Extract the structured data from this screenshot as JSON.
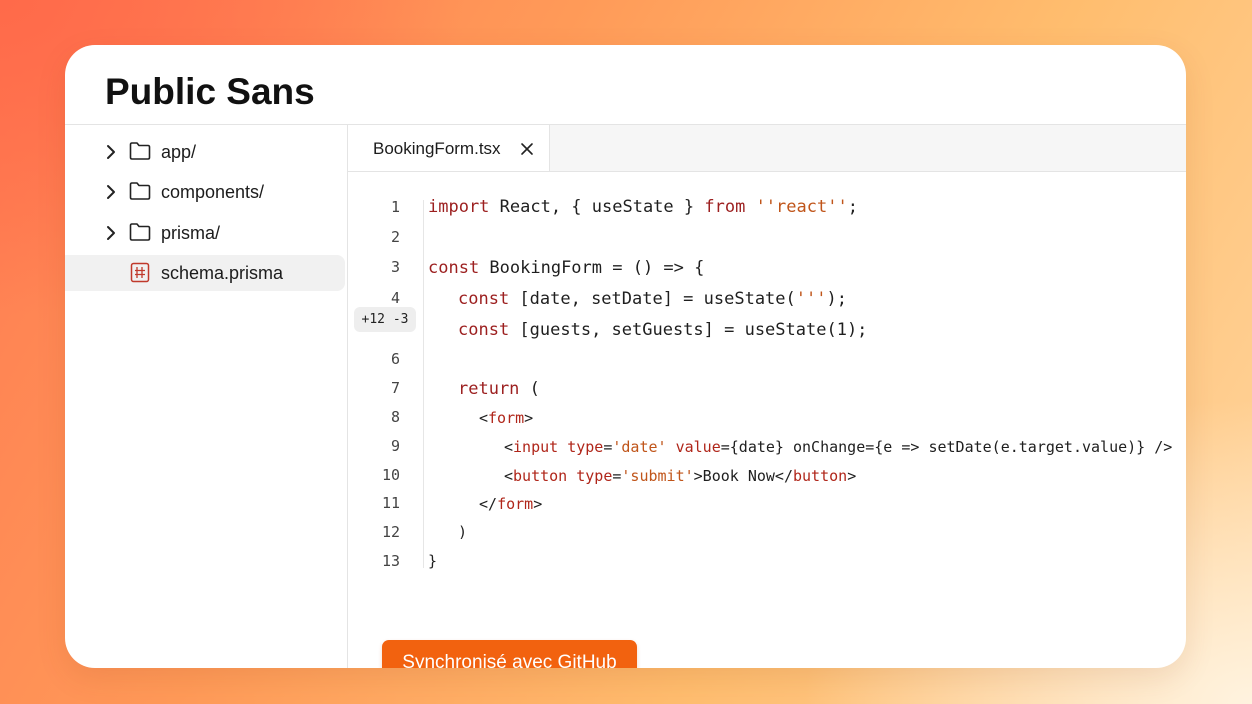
{
  "app": {
    "title": "Public Sans"
  },
  "sidebar": {
    "items": [
      {
        "label": "app/",
        "type": "folder",
        "icon": "folder-icon"
      },
      {
        "label": "components/",
        "type": "folder",
        "icon": "folder-icon"
      },
      {
        "label": "prisma/",
        "type": "folder",
        "icon": "folder-icon"
      },
      {
        "label": "schema.prisma",
        "type": "file",
        "icon": "prisma-file-icon",
        "selected": true
      }
    ]
  },
  "editor": {
    "tab": {
      "label": "BookingForm.tsx",
      "close_icon": "close-icon"
    },
    "diff_badge": "+12 -3",
    "line_numbers": [
      "1",
      "2",
      "3",
      "4",
      "6",
      "7",
      "8",
      "9",
      "10",
      "11",
      "12",
      "13"
    ],
    "code": {
      "line1": [
        "import",
        " React, { useState } ",
        "from",
        " ",
        "''react''",
        ";"
      ],
      "line3": [
        "const",
        " BookingForm = () => {"
      ],
      "line4": [
        "const",
        " [date, setDate] = useState(",
        "'''",
        ");"
      ],
      "line5": [
        "const",
        " [guests, setGuests] = useState(1);"
      ],
      "line7": [
        "return",
        " ("
      ],
      "line8": [
        "<",
        "form",
        ">"
      ],
      "line9": [
        "<",
        "input",
        " ",
        "type",
        "=",
        "'date'",
        " ",
        "value",
        "={date} onChange={e => setDate(e.target.value)} />"
      ],
      "line10": [
        "<",
        "button",
        " ",
        "type",
        "=",
        "'submit'",
        ">Book Now</",
        "button",
        ">"
      ],
      "line11": [
        "</",
        "form",
        ">"
      ],
      "line12": [
        ")"
      ],
      "line13": [
        "}"
      ]
    }
  },
  "actions": {
    "sync_label": "Synchronisé avec GitHub"
  },
  "colors": {
    "accent": "#f2620f",
    "keyword": "#9c1f1f",
    "string": "#c0551a",
    "tag": "#b0261a"
  }
}
